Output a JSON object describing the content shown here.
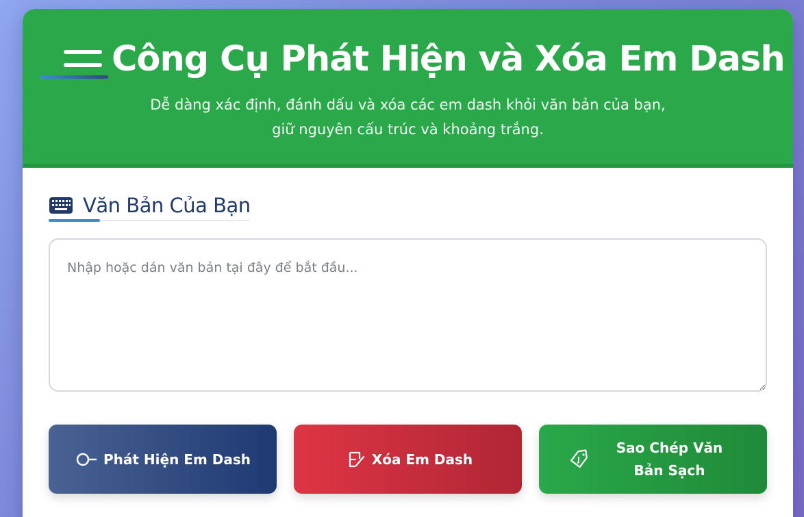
{
  "header": {
    "title": "Công Cụ Phát Hiện và Xóa Em Dash",
    "subtitle_line1": "Dễ dàng xác định, đánh dấu và xóa các em dash khỏi văn bản của bạn,",
    "subtitle_line2": "giữ nguyên cấu trúc và khoảng trắng.",
    "menu_icon": "menu-icon"
  },
  "input_section": {
    "icon": "keyboard-icon",
    "title": "Văn Bản Của Bạn",
    "textarea": {
      "value": "",
      "placeholder": "Nhập hoặc dán văn bản tại đây để bắt đầu..."
    }
  },
  "actions": {
    "detect": {
      "label": "Phát Hiện Em Dash",
      "icon": "search-icon"
    },
    "remove": {
      "label": "Xóa Em Dash",
      "icon": "eraser-icon"
    },
    "copy": {
      "label": "Sao Chép Văn Bản Sạch",
      "icon": "tag-icon"
    }
  },
  "colors": {
    "header_bg": "#2aa84a",
    "title_text": "#1f3a6b",
    "detect_btn": "#1e3a72",
    "remove_btn": "#de3544",
    "copy_btn": "#2aa84a"
  }
}
